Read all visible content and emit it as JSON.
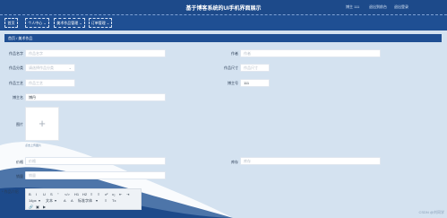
{
  "header": {
    "title": "基于博客系统的UI手机界面展示",
    "user_label": "博主 111",
    "logout": "退出到前台",
    "exit": "退出登录"
  },
  "nav": {
    "home": "首页",
    "personal": "个人中心",
    "works": "美术作品管理",
    "orders": "订单管理"
  },
  "breadcrumb": "首页 / 美术作品",
  "form": {
    "name_label": "作品名字",
    "name_placeholder": "作品名字",
    "author_label": "作者",
    "author_placeholder": "作者",
    "category_label": "作品分类",
    "category_placeholder": "请选择作品分类",
    "size_label": "作品尺寸",
    "size_placeholder": "作品尺寸",
    "craft_label": "作品工艺",
    "craft_placeholder": "作品工艺",
    "blogger_label": "博主号",
    "blogger_value": "111",
    "blogname_label": "博主名",
    "blogname_value": "博丹",
    "image_label": "图片",
    "image_hint": "点击上传图片",
    "price_label": "价格",
    "price_placeholder": "价格",
    "stock_label": "库存",
    "stock_placeholder": "库存",
    "sales_label": "销量",
    "sales_placeholder": "销量",
    "intro_label": "* 作品介绍"
  },
  "editor": {
    "row1": [
      "B",
      "I",
      "U",
      "S",
      "\"",
      "</>",
      "H1",
      "H2",
      "≡",
      "≡",
      "x²",
      "x₂",
      "⇤",
      "⇥"
    ],
    "row2": [
      "14px",
      "▾",
      "文本",
      "▾",
      "A",
      "A",
      "标准字体",
      "▾",
      "≡",
      "Tx"
    ],
    "row3": [
      "🔗",
      "▣",
      "▶"
    ]
  },
  "watermark": "CSDN @刘同学"
}
